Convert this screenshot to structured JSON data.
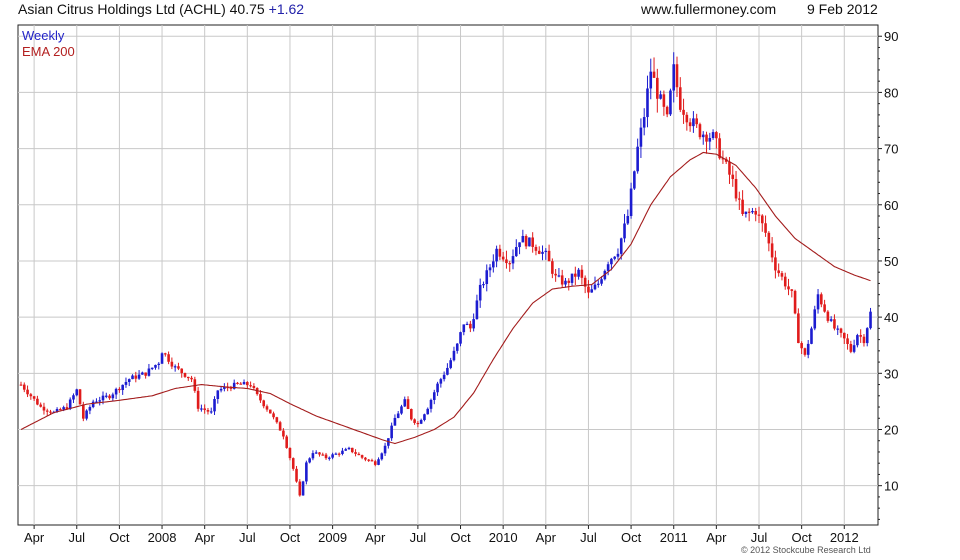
{
  "header": {
    "title": "Asian Citrus Holdings Ltd (ACHL) 40.75",
    "change": "+1.62",
    "site": "www.fullermoney.com",
    "date": "9 Feb 2012"
  },
  "legend": {
    "weekly": "Weekly",
    "ema": "EMA 200"
  },
  "footer": {
    "copyright": "© 2012 Stockcube Research Ltd"
  },
  "chart_data": {
    "type": "candlestick-line",
    "title": "Asian Citrus Holdings Ltd (ACHL) 40.75 +1.62",
    "ylim": [
      3,
      92
    ],
    "y_ticks": [
      10,
      20,
      30,
      40,
      50,
      60,
      70,
      80,
      90
    ],
    "y_axis_side": "right",
    "grid": true,
    "x_ticks": [
      {
        "label": "Apr",
        "week": 4
      },
      {
        "label": "Jul",
        "week": 17
      },
      {
        "label": "Oct",
        "week": 30
      },
      {
        "label": "2008",
        "week": 43
      },
      {
        "label": "Apr",
        "week": 56
      },
      {
        "label": "Jul",
        "week": 69
      },
      {
        "label": "Oct",
        "week": 82
      },
      {
        "label": "2009",
        "week": 95
      },
      {
        "label": "Apr",
        "week": 108
      },
      {
        "label": "Jul",
        "week": 121
      },
      {
        "label": "Oct",
        "week": 134
      },
      {
        "label": "2010",
        "week": 147
      },
      {
        "label": "Apr",
        "week": 160
      },
      {
        "label": "Jul",
        "week": 173
      },
      {
        "label": "Oct",
        "week": 186
      },
      {
        "label": "2011",
        "week": 199
      },
      {
        "label": "Apr",
        "week": 212
      },
      {
        "label": "Jul",
        "week": 225
      },
      {
        "label": "Oct",
        "week": 238
      },
      {
        "label": "2012",
        "week": 251
      }
    ],
    "price_anchors": [
      [
        0,
        28
      ],
      [
        3,
        26
      ],
      [
        6,
        24
      ],
      [
        10,
        23
      ],
      [
        14,
        24
      ],
      [
        17,
        27
      ],
      [
        19,
        22
      ],
      [
        22,
        25
      ],
      [
        27,
        26
      ],
      [
        33,
        29
      ],
      [
        38,
        30
      ],
      [
        42,
        32
      ],
      [
        43,
        34
      ],
      [
        47,
        31
      ],
      [
        52,
        29
      ],
      [
        54,
        24
      ],
      [
        58,
        23
      ],
      [
        60,
        27
      ],
      [
        66,
        28
      ],
      [
        70,
        28
      ],
      [
        72,
        26
      ],
      [
        76,
        23
      ],
      [
        80,
        19
      ],
      [
        83,
        13
      ],
      [
        85,
        8
      ],
      [
        87,
        14
      ],
      [
        89,
        16
      ],
      [
        93,
        15
      ],
      [
        100,
        16.5
      ],
      [
        104,
        15
      ],
      [
        108,
        14
      ],
      [
        111,
        17
      ],
      [
        114,
        22
      ],
      [
        117,
        25
      ],
      [
        119,
        22
      ],
      [
        121,
        21
      ],
      [
        124,
        24
      ],
      [
        127,
        28
      ],
      [
        130,
        31
      ],
      [
        133,
        35
      ],
      [
        135,
        39
      ],
      [
        137,
        38
      ],
      [
        140,
        45
      ],
      [
        143,
        49
      ],
      [
        145,
        52
      ],
      [
        149,
        50
      ],
      [
        152,
        54
      ],
      [
        156,
        53
      ],
      [
        160,
        51
      ],
      [
        163,
        47
      ],
      [
        166,
        46
      ],
      [
        170,
        48
      ],
      [
        173,
        44
      ],
      [
        176,
        46
      ],
      [
        179,
        50
      ],
      [
        182,
        52
      ],
      [
        185,
        58
      ],
      [
        188,
        70
      ],
      [
        190,
        76
      ],
      [
        192,
        84
      ],
      [
        194,
        80
      ],
      [
        197,
        75
      ],
      [
        199,
        84
      ],
      [
        201,
        78
      ],
      [
        204,
        75
      ],
      [
        207,
        73
      ],
      [
        211,
        72
      ],
      [
        214,
        68
      ],
      [
        217,
        64
      ],
      [
        220,
        58
      ],
      [
        224,
        59
      ],
      [
        227,
        55
      ],
      [
        230,
        49
      ],
      [
        233,
        46
      ],
      [
        235,
        44
      ],
      [
        237,
        36
      ],
      [
        239,
        33
      ],
      [
        241,
        38
      ],
      [
        243,
        44
      ],
      [
        246,
        40
      ],
      [
        248,
        38
      ],
      [
        251,
        36
      ],
      [
        253,
        34
      ],
      [
        255,
        37
      ],
      [
        257,
        36
      ],
      [
        259,
        40.75
      ]
    ],
    "ema_anchors": [
      [
        0,
        20
      ],
      [
        10,
        23
      ],
      [
        20,
        24.5
      ],
      [
        30,
        25.2
      ],
      [
        40,
        26
      ],
      [
        47,
        27.3
      ],
      [
        55,
        28
      ],
      [
        62,
        27.6
      ],
      [
        69,
        27.3
      ],
      [
        76,
        26.4
      ],
      [
        82,
        24.6
      ],
      [
        90,
        22.4
      ],
      [
        100,
        20.3
      ],
      [
        110,
        18.2
      ],
      [
        114,
        17.5
      ],
      [
        120,
        18.6
      ],
      [
        126,
        20
      ],
      [
        132,
        22.2
      ],
      [
        138,
        26.5
      ],
      [
        144,
        32.5
      ],
      [
        150,
        38
      ],
      [
        156,
        42.5
      ],
      [
        162,
        45
      ],
      [
        168,
        45.5
      ],
      [
        174,
        45.8
      ],
      [
        180,
        48.5
      ],
      [
        186,
        53
      ],
      [
        192,
        60
      ],
      [
        198,
        65
      ],
      [
        204,
        68
      ],
      [
        208,
        69.3
      ],
      [
        212,
        69
      ],
      [
        218,
        67
      ],
      [
        224,
        63
      ],
      [
        230,
        58
      ],
      [
        236,
        54
      ],
      [
        242,
        51.5
      ],
      [
        248,
        49
      ],
      [
        254,
        47.5
      ],
      [
        259,
        46.5
      ]
    ]
  }
}
